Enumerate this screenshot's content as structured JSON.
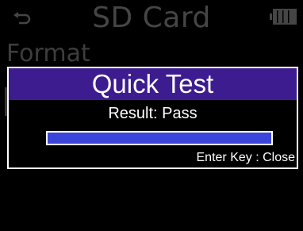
{
  "screen": {
    "title": "SD Card",
    "menu_item": "Format",
    "back_icon": "back-arrow-icon",
    "battery_icon": "battery-icon"
  },
  "dialog": {
    "title": "Quick Test",
    "result": "Result: Pass",
    "progress": 1.0,
    "hint": "Enter Key : Close"
  },
  "colors": {
    "header": "#3c1c8e",
    "progress_fill": "#3c45d9",
    "background_dim": "#454545"
  }
}
